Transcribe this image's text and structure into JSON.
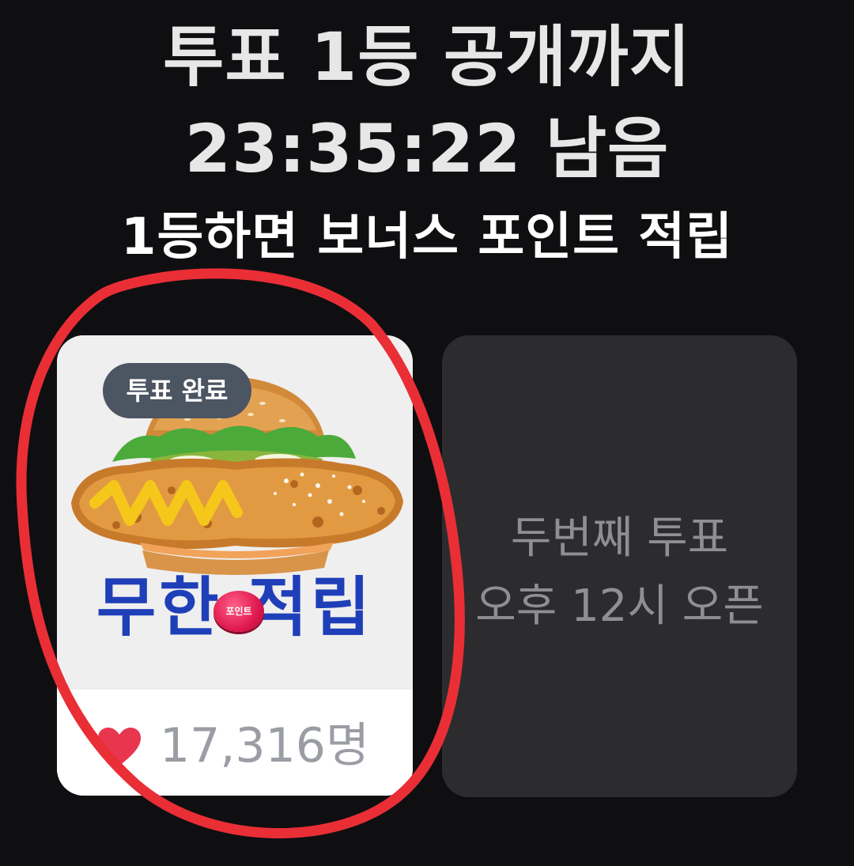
{
  "header": {
    "line1": "투표 1등 공개까지",
    "line2": "23:35:22 남음",
    "line3": "1등하면 보너스 포인트 적립"
  },
  "vote_card": {
    "badge": "투표 완료",
    "promo_text": "무한 적립",
    "coin_text": "포인트",
    "like_count": "17,316명",
    "product": "chicken burger image"
  },
  "next_card": {
    "line1": "두번째 투표",
    "line2": "오후 12시 오픈"
  },
  "colors": {
    "background": "#0f0f11",
    "badge": "#4c5562",
    "heart": "#e8364f",
    "promo": "#1f3fb8",
    "annotation": "#ea2e36"
  }
}
